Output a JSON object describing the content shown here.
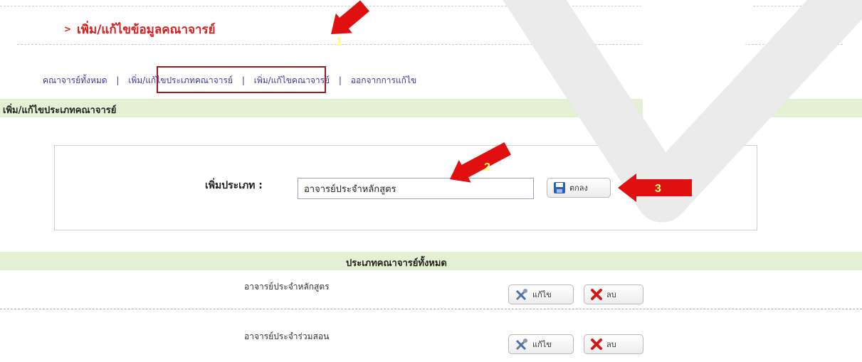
{
  "header": {
    "title": "เพิ่ม/แก้ไขข้อมูลคณาจารย์",
    "chevron": ">"
  },
  "nav_links": [
    "คณาจารย์ทั้งหมด",
    "เพิ่ม/แก้ไขประเภทคณาจารย์",
    "เพิ่ม/แก้ไขคณาจารย์",
    "ออกจากการแก้ไข"
  ],
  "nav_separator": "|",
  "section_title": "เพิ่ม/แก้ไขประเภทคณาจารย์",
  "form": {
    "label": "เพิ่มประเภท :",
    "input_value": "อาจารย์ประจำหลักสูตร",
    "ok_label": "ตกลง"
  },
  "list": {
    "header": "ประเภทคณาจารย์ทั้งหมด",
    "rows": [
      {
        "name": "อาจารย์ประจำหลักสูตร",
        "edit_label": "แก้ไข",
        "delete_label": "ลบ"
      },
      {
        "name": "อาจารย์ประจำร่วมสอน",
        "edit_label": "แก้ไข",
        "delete_label": "ลบ"
      }
    ]
  },
  "annotations": [
    "1",
    "2",
    "3"
  ],
  "colors": {
    "accent_red": "#d62020",
    "link_blue": "#3b3b9a",
    "section_green": "#e4f0d4",
    "arrow_red": "#e01010"
  }
}
